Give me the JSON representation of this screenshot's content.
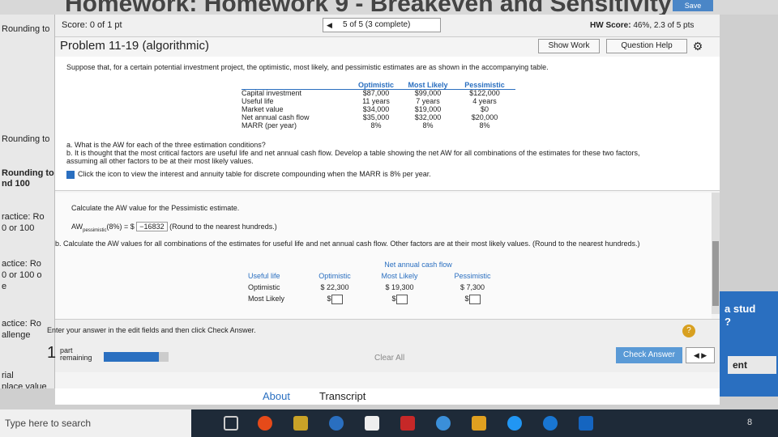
{
  "window": {
    "title": "Homework: Homework 9 - Breakeven and Sensitivity",
    "save_label": "Save"
  },
  "left_panel": {
    "items": [
      "Rounding to",
      "Rounding to",
      "Rounding to",
      "nd 100",
      "ractice: Ro",
      "0 or 100",
      "actice: Ro",
      "0 or 100 o",
      "e",
      "actice: Ro",
      "allenge",
      "rial",
      "place value"
    ]
  },
  "header": {
    "score": "Score: 0 of 1 pt",
    "nav": "5 of 5 (3 complete)",
    "hw_score_label": "HW Score:",
    "hw_score_value": "46%, 2.3 of 5 pts",
    "problem_title": "Problem 11-19 (algorithmic)",
    "show_work": "Show Work",
    "question_help": "Question Help"
  },
  "problem": {
    "intro": "Suppose that, for a certain potential investment project, the optimistic, most likely, and pessimistic estimates are as shown in the accompanying table.",
    "table": {
      "headers": [
        "Optimistic",
        "Most Likely",
        "Pessimistic"
      ],
      "rows": [
        {
          "label": "Capital investment",
          "values": [
            "$87,000",
            "$99,000",
            "$122,000"
          ]
        },
        {
          "label": "Useful life",
          "values": [
            "11 years",
            "7 years",
            "4 years"
          ]
        },
        {
          "label": "Market value",
          "values": [
            "$34,000",
            "$19,000",
            "$0"
          ]
        },
        {
          "label": "Net annual cash flow",
          "values": [
            "$35,000",
            "$32,000",
            "$20,000"
          ]
        },
        {
          "label": "MARR (per year)",
          "values": [
            "8%",
            "8%",
            "8%"
          ]
        }
      ]
    },
    "qa": "a. What is the AW for each of the three estimation conditions?",
    "qb1": "b. It is thought that the most critical factors are useful life and net annual cash flow. Develop a table showing the net AW for all combinations of the estimates for these two factors,",
    "qb2": "assuming all other factors to be at their most likely values.",
    "click_note": "Click the icon to view the interest and annuity table for discrete compounding when the MARR is 8% per year."
  },
  "answer": {
    "calc_label": "Calculate the AW value for the Pessimistic estimate.",
    "aw_prefix": "AW",
    "aw_sub": "pessimistic",
    "aw_mid": "(8%) = $",
    "aw_value": "−16832",
    "aw_note": "(Round to the nearest hundreds.)",
    "b_label": "b. Calculate the AW values for all combinations of the estimates for useful life and net annual cash flow. Other factors are at their most likely values. (Round to the nearest hundreds.)",
    "table": {
      "group_header": "Net annual cash flow",
      "row_header": "Useful life",
      "headers": [
        "Optimistic",
        "Most Likely",
        "Pessimistic"
      ],
      "rows": [
        {
          "label": "Optimistic",
          "values": [
            "$ 22,300",
            "$ 19,300",
            "$ 7,300"
          ]
        },
        {
          "label": "Most Likely",
          "values": [
            "$",
            "$",
            "$"
          ]
        }
      ]
    }
  },
  "footer": {
    "enter_text": "Enter your answer in the edit fields and then click Check Answer.",
    "part_num": "1",
    "part_text_1": "part",
    "part_text_2": "remaining",
    "progress": 0.85,
    "clear_all": "Clear All",
    "check_answer": "Check Answer"
  },
  "right_panel": {
    "line1": "a stud",
    "line2": "?",
    "line3": "ent"
  },
  "bottom_tabs": {
    "about": "About",
    "transcript": "Transcript"
  },
  "taskbar": {
    "search": "Type here to search",
    "clock": "8"
  }
}
